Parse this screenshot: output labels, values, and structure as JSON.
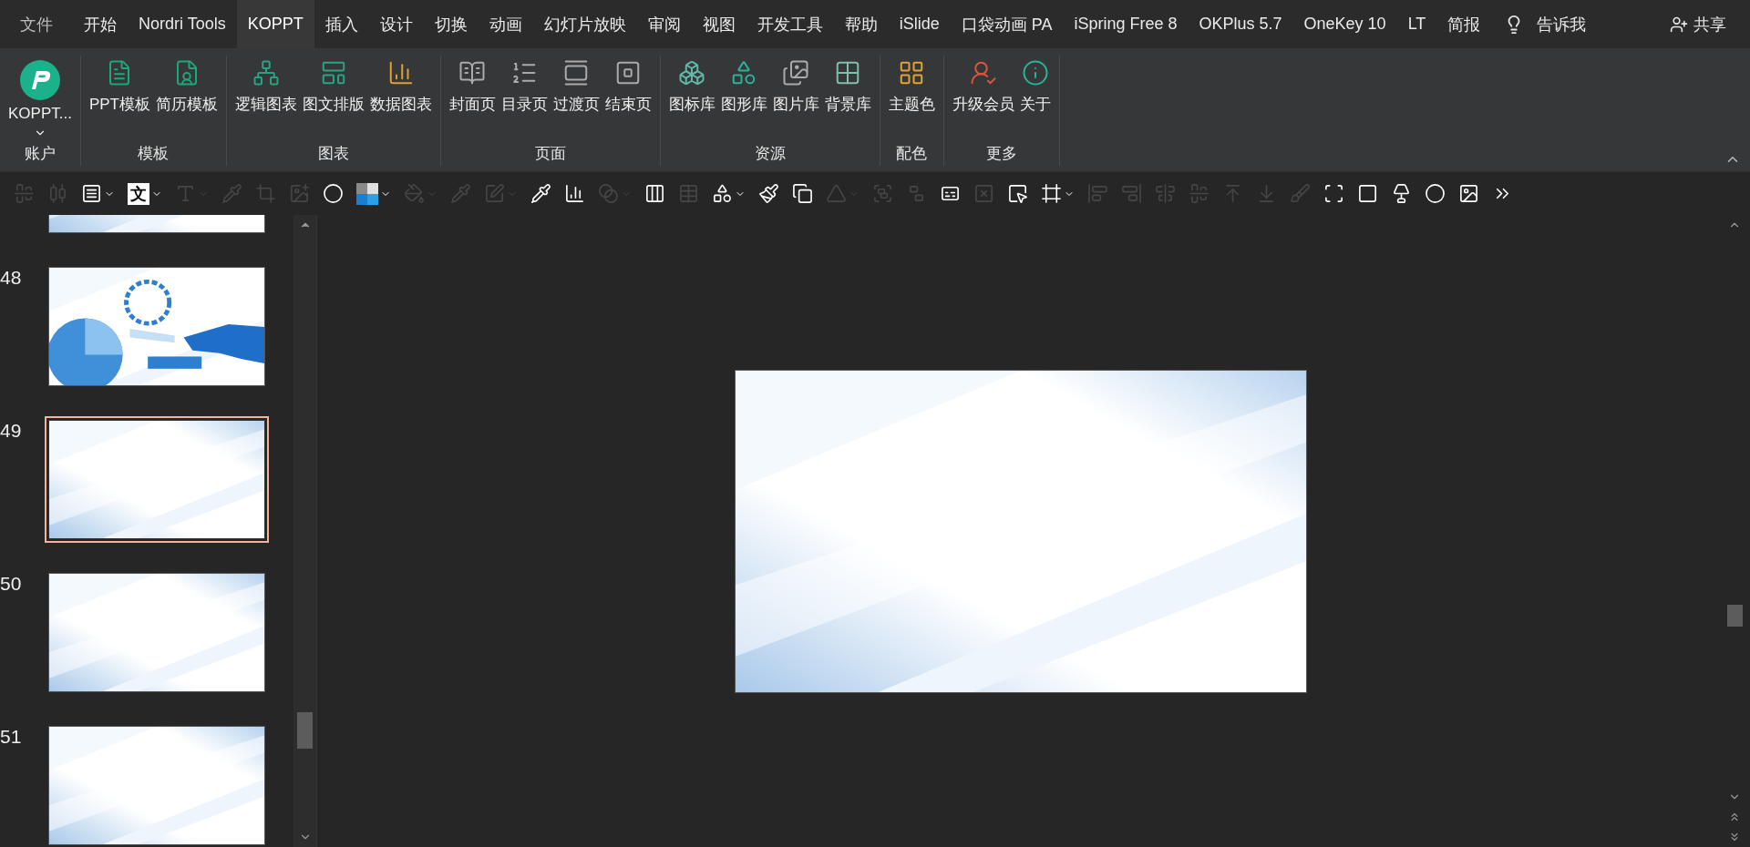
{
  "tabs": [
    {
      "label": "文件",
      "selected": false,
      "kind": "file"
    },
    {
      "label": "开始",
      "selected": false
    },
    {
      "label": "Nordri Tools",
      "selected": false
    },
    {
      "label": "KOPPT",
      "selected": true
    },
    {
      "label": "插入",
      "selected": false
    },
    {
      "label": "设计",
      "selected": false
    },
    {
      "label": "切换",
      "selected": false
    },
    {
      "label": "动画",
      "selected": false
    },
    {
      "label": "幻灯片放映",
      "selected": false
    },
    {
      "label": "审阅",
      "selected": false
    },
    {
      "label": "视图",
      "selected": false
    },
    {
      "label": "开发工具",
      "selected": false
    },
    {
      "label": "帮助",
      "selected": false
    },
    {
      "label": "iSlide",
      "selected": false
    },
    {
      "label": "口袋动画 PA",
      "selected": false
    },
    {
      "label": "iSpring Free 8",
      "selected": false
    },
    {
      "label": "OKPlus 5.7",
      "selected": false
    },
    {
      "label": "OneKey 10",
      "selected": false
    },
    {
      "label": "LT",
      "selected": false
    },
    {
      "label": "简报",
      "selected": false
    }
  ],
  "tell_me": "告诉我",
  "share": "共享",
  "ribbon_groups": [
    {
      "label": "账户",
      "buttons": [
        {
          "label": "KOPPT...",
          "kind": "account"
        }
      ]
    },
    {
      "label": "模板",
      "buttons": [
        {
          "label": "PPT模板"
        },
        {
          "label": "简历模板"
        }
      ]
    },
    {
      "label": "图表",
      "buttons": [
        {
          "label": "逻辑图表"
        },
        {
          "label": "图文排版"
        },
        {
          "label": "数据图表"
        }
      ]
    },
    {
      "label": "页面",
      "buttons": [
        {
          "label": "封面页"
        },
        {
          "label": "目录页"
        },
        {
          "label": "过渡页"
        },
        {
          "label": "结束页"
        }
      ]
    },
    {
      "label": "资源",
      "buttons": [
        {
          "label": "图标库"
        },
        {
          "label": "图形库"
        },
        {
          "label": "图片库"
        },
        {
          "label": "背景库"
        }
      ]
    },
    {
      "label": "配色",
      "buttons": [
        {
          "label": "主题色"
        }
      ]
    },
    {
      "label": "更多",
      "buttons": [
        {
          "label": "升级会员"
        },
        {
          "label": "关于"
        }
      ]
    }
  ],
  "toolbar": [
    {
      "kind": "icon",
      "disabled": true,
      "dropdown": false
    },
    {
      "kind": "icon",
      "disabled": true,
      "dropdown": false
    },
    {
      "kind": "icon",
      "disabled": false,
      "dropdown": true
    },
    {
      "kind": "glyph",
      "label": "文",
      "disabled": false,
      "dropdown": true
    },
    {
      "kind": "icon",
      "disabled": true,
      "dropdown": true
    },
    {
      "kind": "icon",
      "disabled": true,
      "dropdown": false
    },
    {
      "kind": "icon",
      "disabled": true,
      "dropdown": false
    },
    {
      "kind": "icon",
      "disabled": true,
      "dropdown": false
    },
    {
      "kind": "icon",
      "disabled": false,
      "dropdown": false
    },
    {
      "kind": "swatch",
      "disabled": false,
      "dropdown": true
    },
    {
      "kind": "icon",
      "disabled": true,
      "dropdown": true
    },
    {
      "kind": "icon",
      "disabled": true,
      "dropdown": false
    },
    {
      "kind": "icon",
      "disabled": true,
      "dropdown": true
    },
    {
      "kind": "icon",
      "disabled": false,
      "dropdown": false
    },
    {
      "kind": "icon",
      "disabled": false,
      "dropdown": false
    },
    {
      "kind": "icon",
      "disabled": true,
      "dropdown": true
    },
    {
      "kind": "icon",
      "disabled": false,
      "dropdown": false
    },
    {
      "kind": "icon",
      "disabled": true,
      "dropdown": false
    },
    {
      "kind": "icon",
      "disabled": false,
      "dropdown": true
    },
    {
      "kind": "icon",
      "disabled": false,
      "dropdown": false
    },
    {
      "kind": "icon",
      "disabled": false,
      "dropdown": false
    },
    {
      "kind": "icon",
      "disabled": true,
      "dropdown": true
    },
    {
      "kind": "icon",
      "disabled": true,
      "dropdown": false
    },
    {
      "kind": "icon",
      "disabled": true,
      "dropdown": false
    },
    {
      "kind": "icon",
      "disabled": false,
      "dropdown": false
    },
    {
      "kind": "icon",
      "disabled": true,
      "dropdown": false
    },
    {
      "kind": "icon",
      "disabled": false,
      "dropdown": false
    },
    {
      "kind": "icon",
      "disabled": false,
      "dropdown": true
    },
    {
      "kind": "icon",
      "disabled": true,
      "dropdown": false
    },
    {
      "kind": "icon",
      "disabled": true,
      "dropdown": false
    },
    {
      "kind": "icon",
      "disabled": true,
      "dropdown": false
    },
    {
      "kind": "icon",
      "disabled": true,
      "dropdown": false
    },
    {
      "kind": "icon",
      "disabled": true,
      "dropdown": false
    },
    {
      "kind": "icon",
      "disabled": true,
      "dropdown": false
    },
    {
      "kind": "icon",
      "disabled": true,
      "dropdown": false
    },
    {
      "kind": "icon",
      "disabled": false,
      "dropdown": false
    },
    {
      "kind": "icon",
      "disabled": false,
      "dropdown": false
    },
    {
      "kind": "icon",
      "disabled": false,
      "dropdown": false
    },
    {
      "kind": "icon",
      "disabled": false,
      "dropdown": false
    },
    {
      "kind": "icon",
      "disabled": false,
      "dropdown": false
    },
    {
      "kind": "icon",
      "disabled": false,
      "dropdown": false
    }
  ],
  "slides": [
    {
      "selected": false,
      "kind": "picture"
    },
    {
      "number": "48",
      "selected": false,
      "kind": "picture"
    },
    {
      "number": "49",
      "selected": true,
      "kind": "picture"
    },
    {
      "number": "50",
      "selected": false,
      "kind": "picture"
    },
    {
      "number": "51",
      "selected": false,
      "kind": "picture"
    }
  ],
  "canvas": {
    "kind": "picture"
  }
}
